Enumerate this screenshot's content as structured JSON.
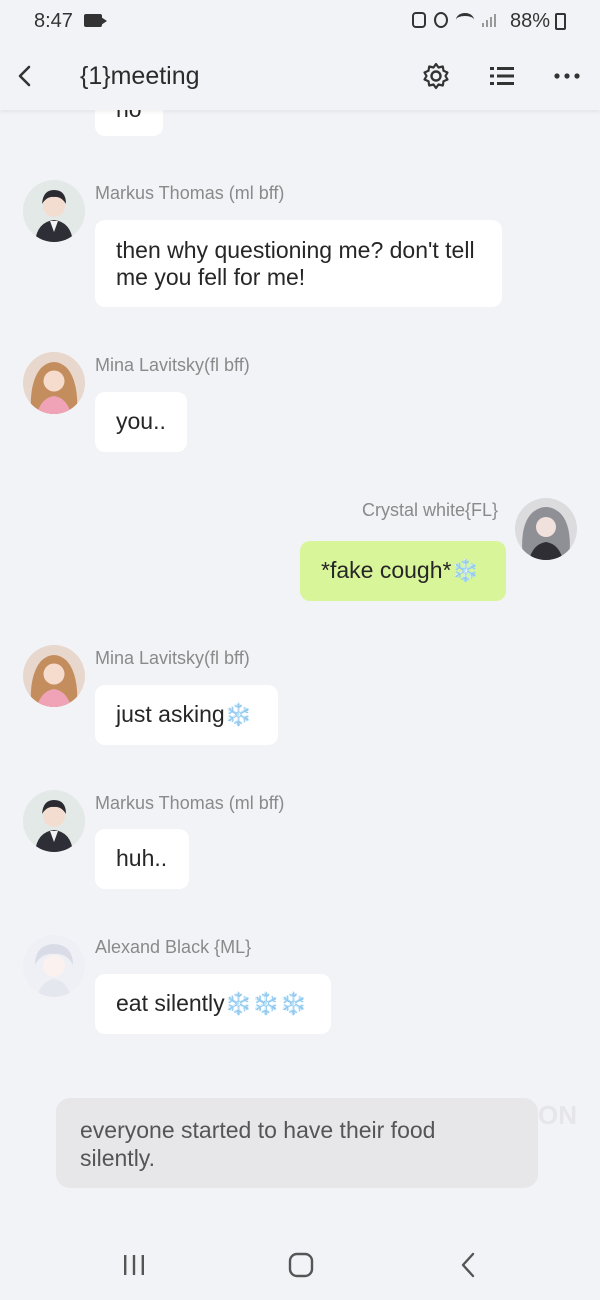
{
  "status_bar": {
    "time": "8:47",
    "battery": "88%",
    "icons": [
      "video-recording-icon",
      "battery-saver-icon",
      "alarm-icon",
      "wifi-icon",
      "signal-icon",
      "battery-charging-icon"
    ]
  },
  "header": {
    "title": "{1}meeting",
    "icons": [
      "back-arrow-icon",
      "settings-gear-icon",
      "list-menu-icon",
      "more-dots-icon"
    ]
  },
  "messages": [
    {
      "id": 0,
      "sender": "",
      "text": "no",
      "side": "left",
      "partial": true
    },
    {
      "id": 1,
      "sender": "Markus Thomas  (ml bff)",
      "text": "then why questioning me? don't tell me you fell for me!",
      "side": "left",
      "avatar": "markus-avatar"
    },
    {
      "id": 2,
      "sender": "Mina Lavitsky(fl bff)",
      "text": "you..",
      "side": "left",
      "avatar": "mina-avatar"
    },
    {
      "id": 3,
      "sender": "Crystal white{FL}",
      "text": "*fake cough*",
      "emoji": "❄️",
      "side": "right",
      "avatar": "crystal-avatar"
    },
    {
      "id": 4,
      "sender": "Mina Lavitsky(fl bff)",
      "text": "just asking",
      "emoji": "❄️",
      "side": "left",
      "avatar": "mina-avatar"
    },
    {
      "id": 5,
      "sender": "Markus Thomas  (ml bff)",
      "text": "huh..",
      "side": "left",
      "avatar": "markus-avatar"
    },
    {
      "id": 6,
      "sender": "Alexand Black {ML}",
      "text": "eat silently",
      "emoji": "❄️❄️❄️",
      "side": "left",
      "avatar": "alexand-avatar"
    }
  ],
  "narration": "everyone started to have their food silently.",
  "watermark": "ON",
  "colors": {
    "background": "#f2f3f7",
    "bubble": "#ffffff",
    "my_bubble": "#d9f59a",
    "narration_bg": "#e7e7e9",
    "sender_text": "#8a8a8a"
  },
  "nav_bar": {
    "icons": [
      "recent-apps-icon",
      "home-icon",
      "back-icon"
    ]
  }
}
